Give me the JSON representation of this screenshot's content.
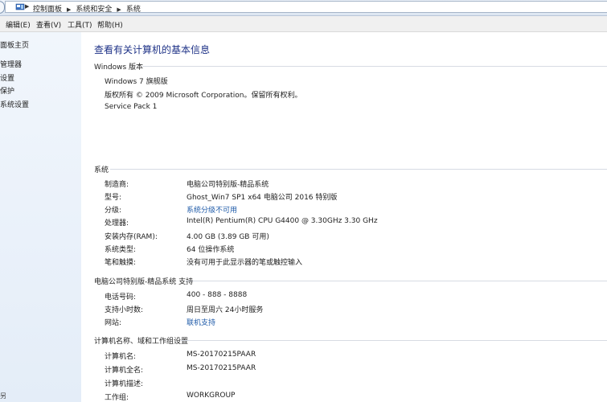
{
  "breadcrumb": [
    "控制面板",
    "系统和安全",
    "系统"
  ],
  "menu": [
    "编辑(E)",
    "查看(V)",
    "工具(T)",
    "帮助(H)"
  ],
  "leftnav": {
    "items": [
      "面板主页",
      "管理器",
      "设置",
      "保护",
      "系统设置"
    ],
    "see_also": "另"
  },
  "page_title": "查看有关计算机的基本信息",
  "edition": {
    "header": "Windows 版本",
    "lines": [
      "Windows 7 旗舰版",
      "版权所有 © 2009 Microsoft Corporation。保留所有权利。",
      "Service Pack 1"
    ]
  },
  "system": {
    "header": "系统",
    "rows": [
      {
        "label": "制造商:",
        "value": "电脑公司特别版-精品系统"
      },
      {
        "label": "型号:",
        "value": "Ghost_Win7 SP1 x64 电脑公司 2016 特别版"
      },
      {
        "label": "分级:",
        "value": "系统分级不可用",
        "link": true
      },
      {
        "label": "处理器:",
        "value": "Intel(R) Pentium(R) CPU G4400 @ 3.30GHz   3.30 GHz"
      },
      {
        "label": "安装内存(RAM):",
        "value": "4.00 GB (3.89 GB 可用)"
      },
      {
        "label": "系统类型:",
        "value": "64 位操作系统"
      },
      {
        "label": "笔和触摸:",
        "value": "没有可用于此显示器的笔或触控输入"
      }
    ]
  },
  "support": {
    "header": "电脑公司特别版-精品系统 支持",
    "rows": [
      {
        "label": "电话号码:",
        "value": "400 - 888 - 8888"
      },
      {
        "label": "支持小时数:",
        "value": "周日至周六  24小时服务"
      },
      {
        "label": "网站:",
        "value": "联机支持",
        "link": true
      }
    ]
  },
  "computer": {
    "header": "计算机名称、域和工作组设置",
    "rows": [
      {
        "label": "计算机名:",
        "value": "MS-20170215PAAR"
      },
      {
        "label": "计算机全名:",
        "value": "MS-20170215PAAR"
      },
      {
        "label": "计算机描述:",
        "value": ""
      },
      {
        "label": "工作组:",
        "value": "WORKGROUP"
      }
    ]
  },
  "colors": {
    "link": "#1e5aa8",
    "title": "#1e3287",
    "nav_bg": "#e4edf8"
  }
}
